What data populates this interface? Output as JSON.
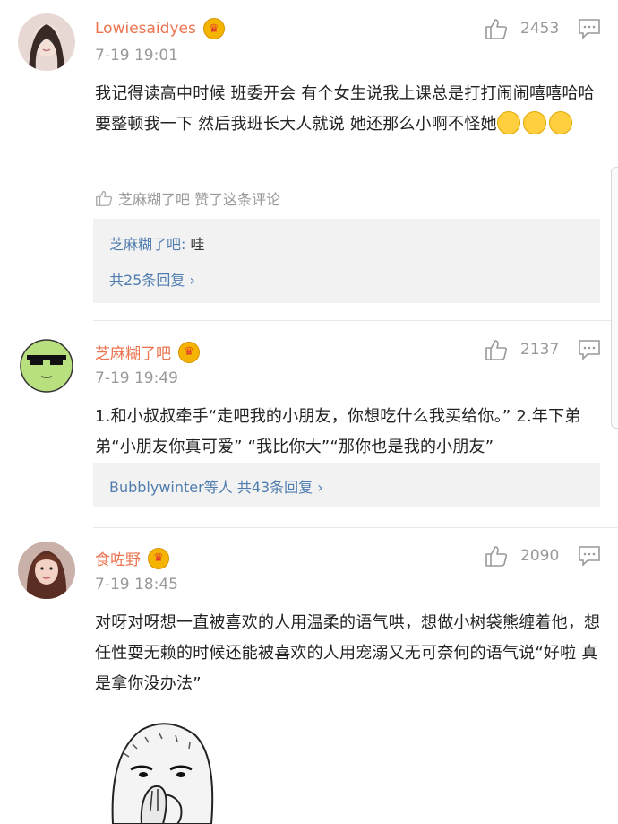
{
  "comments": [
    {
      "username": "Lowiesaidyes",
      "time": "7-19 19:01",
      "likes": "2453",
      "text": "我记得读高中时候 班委开会 有个女生说我上课总是打打闹闹嘻嘻哈哈 要整顿我一下 然后我班长大人就说 她还那么小啊不怪她",
      "emoji_count": 3,
      "liked_by": "芝麻糊了吧 赞了这条评论",
      "reply_author": "芝麻糊了吧:",
      "reply_text": " 哇",
      "reply_more": "共25条回复 ›"
    },
    {
      "username": "芝麻糊了吧",
      "time": "7-19 19:49",
      "likes": "2137",
      "text": "1.和小叔叔牵手“走吧我的小朋友，你想吃什么我买给你。” 2.年下弟弟“小朋友你真可爱” “我比你大”“那你也是我的小朋友”",
      "reply_users": "Bubblywinter等人",
      "reply_more": "共43条回复 ›"
    },
    {
      "username": "食咗野",
      "time": "7-19 18:45",
      "likes": "2090",
      "text": "对呀对呀想一直被喜欢的人用温柔的语气哄，想做小树袋熊缠着他，想任性耍无赖的时候还能被喜欢的人用宠溺又无可奈何的语气说“好啦 真是拿你没办法”"
    }
  ],
  "colors": {
    "username": "#eb7350",
    "link": "#507daf",
    "meta": "#999999",
    "reply_bg": "#f2f2f2"
  },
  "icons": [
    "thumbs-up-icon",
    "comment-icon",
    "vip-crown-icon",
    "smile-emoji"
  ]
}
